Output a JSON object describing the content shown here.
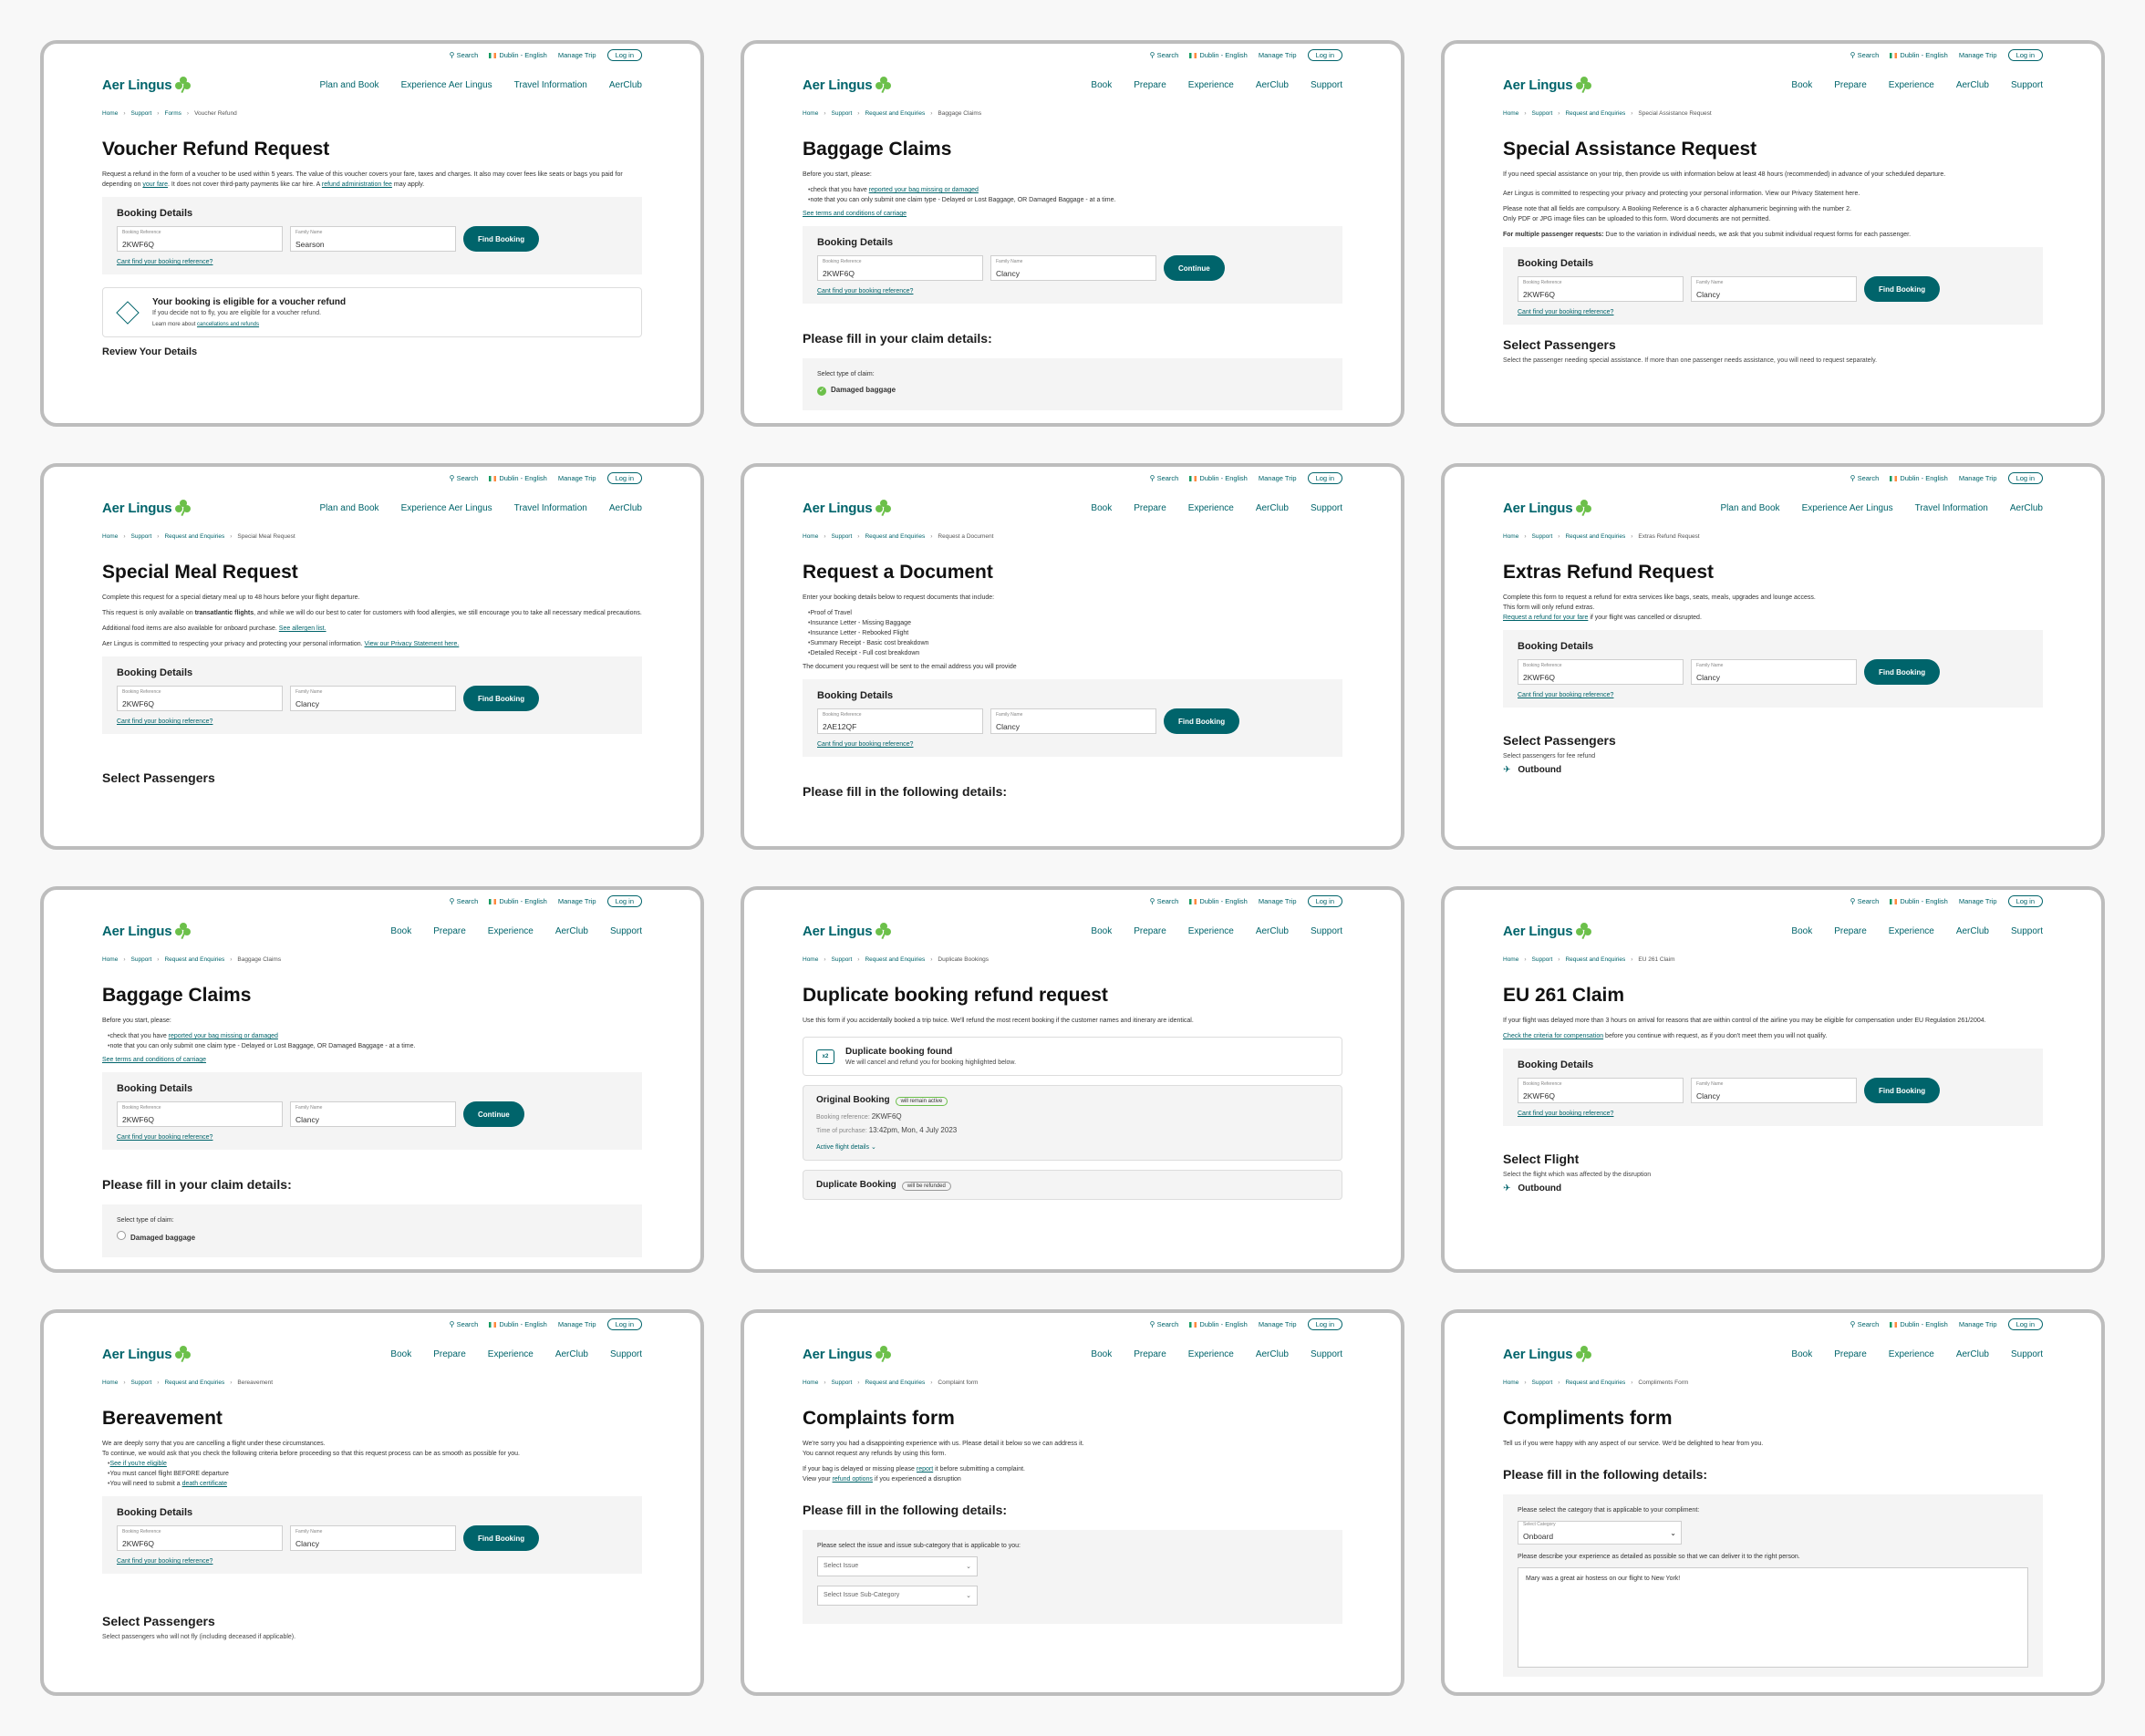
{
  "header": {
    "search": "Search",
    "locale": "Dublin - English",
    "manage": "Manage Trip",
    "login": "Log in",
    "brand": "Aer Lingus",
    "nav_a": [
      "Plan and Book",
      "Experience Aer Lingus",
      "Travel Information",
      "AerClub"
    ],
    "nav_b": [
      "Book",
      "Prepare",
      "Experience",
      "AerClub",
      "Support"
    ]
  },
  "common": {
    "booking_details": "Booking Details",
    "ref_label": "Booking Reference",
    "name_label": "Family Name",
    "cant_find": "Cant find your booking reference?",
    "find": "Find Booking",
    "continue": "Continue",
    "home": "Home",
    "support": "Support",
    "forms": "Forms",
    "req": "Request and Enquiries"
  },
  "cards": {
    "c1": {
      "crumb": "Voucher Refund",
      "title": "Voucher Refund Request",
      "p1a": "Request a refund in the form of a voucher to be used within 5 years. The value of this voucher covers your fare, taxes and charges. It also may cover fees like seats or bags you paid for depending on ",
      "p1link": "your fare",
      "p1b": ". It does not cover third-party payments like car hire. A ",
      "p1link2": "refund administration fee",
      "p1c": " may apply.",
      "ref": "2KWF6Q",
      "name": "Searson",
      "elig_title": "Your booking is eligible for a voucher refund",
      "elig_sub": "If you decide not to fly, you are eligible for a voucher refund.",
      "elig_more_a": "Learn more about ",
      "elig_more_link": "cancellations and refunds",
      "review": "Review Your Details"
    },
    "c2": {
      "crumb": "Baggage Claims",
      "title": "Baggage Claims",
      "intro": "Before you start, please:",
      "li1a": "check that you have ",
      "li1link": "reported your bag missing or damaged",
      "li2": "note that you can only submit one claim type - Delayed or Lost Baggage, OR Damaged Baggage - at a time.",
      "terms": "See terms and conditions of carriage",
      "ref": "2KWF6Q",
      "name": "Clancy",
      "h2": "Please fill in your claim details:",
      "claim_label": "Select type of claim:",
      "claim_opt": "Damaged baggage"
    },
    "c3": {
      "crumb": "Special Assistance Request",
      "title": "Special Assistance Request",
      "p1": "If you need special assistance on your trip, then provide us with information below at least 48 hours (recommended) in advance of your scheduled departure.",
      "p2": "Aer Lingus is committed to respecting your privacy and protecting your personal information. View our Privacy Statement here.",
      "p3": "Please note that all fields are compulsory. A Booking Reference is a 6 character alphanumeric beginning with the number 2.",
      "p4": "Only PDF or JPG image files can be uploaded to this form. Word documents are not permitted.",
      "p5b": "For multiple passenger requests:",
      "p5": " Due to the variation in individual needs, we ask that you submit individual request forms for each passenger.",
      "ref": "2KWF6Q",
      "name": "Clancy",
      "h2": "Select Passengers",
      "sub": "Select the passenger needing special assistance. If more than one passenger needs assistance, you will need to request separately."
    },
    "c4": {
      "crumb": "Special Meal Request",
      "title": "Special Meal Request",
      "p1": "Complete this request for a special dietary meal up to 48 hours before your flight departure.",
      "p2a": "This request is only available on ",
      "p2b": "transatlantic flights",
      "p2c": ", and while we will do our best to cater for customers with food allergies, we still encourage you to take all necessary medical precautions.",
      "p3a": "Additional food items are also available for onboard purchase. ",
      "p3link": "See allergen list.",
      "p4a": "Aer Lingus is committed to respecting your privacy and protecting your personal information. ",
      "p4link": "View our Privacy Statement here.",
      "ref": "2KWF6Q",
      "name": "Clancy",
      "h2": "Select Passengers"
    },
    "c5": {
      "crumb": "Request a Document",
      "title": "Request a Document",
      "intro": "Enter your booking details below to request documents that include:",
      "items": [
        "Proof of Travel",
        "Insurance Letter - Missing Baggage",
        "Insurance Letter - Rebooked Flight",
        "Summary Receipt - Basic cost breakdown",
        "Detailed Receipt - Full cost breakdown"
      ],
      "p2": "The document you request will be sent to the email address you will provide",
      "ref": "2AE12QF",
      "name": "Clancy",
      "h2": "Please fill in the following details:"
    },
    "c6": {
      "crumb": "Extras Refund Request",
      "title": "Extras Refund Request",
      "p1": "Complete this form to request a refund for extra services like bags, seats, meals, upgrades and lounge access.",
      "p2": "This form will only refund extras.",
      "p3link": "Request a refund for your fare",
      "p3": " if your flight was cancelled or disrupted.",
      "ref": "2KWF6Q",
      "name": "Clancy",
      "h2": "Select Passengers",
      "sub": "Select passengers for fee refund",
      "outbound": "Outbound"
    },
    "c7": {
      "crumb": "Baggage Claims",
      "title": "Baggage Claims",
      "intro": "Before you start, please:",
      "li1a": "check that you have ",
      "li1link": "reported your bag missing or damaged",
      "li2": "note that you can only submit one claim type - Delayed or Lost Baggage, OR Damaged Baggage - at a time.",
      "terms": "See terms and conditions of carriage",
      "ref": "2KWF6Q",
      "name": "Clancy",
      "h2": "Please fill in your claim details:",
      "claim_label": "Select type of claim:",
      "claim_opt": "Damaged baggage"
    },
    "c8": {
      "crumb": "Duplicate Bookings",
      "title": "Duplicate booking refund request",
      "p1": "Use this form if you accidentally booked a trip twice. We'll refund the most recent booking if the customer names and itinerary are identical.",
      "found_title": "Duplicate booking found",
      "found_sub": "We will cancel and refund you for booking highlighted below.",
      "orig_title": "Original Booking",
      "orig_tag": "will remain active",
      "ref_label": "Booking reference:",
      "ref": "2KWF6Q",
      "time_label": "Time of purchase:",
      "time": "13:42pm, Mon, 4 July 2023",
      "active": "Active flight details",
      "dup_title": "Duplicate Booking",
      "dup_tag": "will be refunded"
    },
    "c9": {
      "crumb": "EU 261 Claim",
      "title": "EU 261 Claim",
      "p1": "If your flight was delayed more than 3 hours on arrival for reasons that are within control of the airline you may be eligible for compensation under EU Regulation 261/2004.",
      "p2link": "Check the criteria for compensation",
      "p2": " before you continue with request, as if you don't meet them you will not qualify.",
      "ref": "2KWF6Q",
      "name": "Clancy",
      "h2": "Select Flight",
      "sub": "Select the flight which was affected by the disruption",
      "outbound": "Outbound"
    },
    "c10": {
      "crumb": "Bereavement",
      "title": "Bereavement",
      "p1": "We are deeply sorry that you are cancelling a flight under these circumstances.",
      "p2": "To continue, we would ask that you check the following criteria before proceeding so that this request process can be as smooth as possible for you.",
      "li1": "See if you're eligible",
      "li2": "You must cancel flight BEFORE departure",
      "li3a": "You will need to submit a ",
      "li3link": "death certificate",
      "ref": "2KWF6Q",
      "name": "Clancy",
      "h2": "Select Passengers",
      "sub": "Select passengers who will not fly (including deceased if applicable)."
    },
    "c11": {
      "crumb": "Complaint form",
      "title": "Complaints form",
      "p1": "We're sorry you had a disappointing experience with us. Please detail it below so we can address it.",
      "p2": "You cannot request any refunds by using this form.",
      "p3a": "If your bag is delayed or missing please ",
      "p3link": "report",
      "p3b": " it before submitting a complaint.",
      "p4a": "View your ",
      "p4link": "refund options",
      "p4b": " if you experienced a disruption",
      "h2": "Please fill in the following details:",
      "sel_label": "Please select the issue and issue sub-category that is applicable to you:",
      "sel1": "Select Issue",
      "sel2": "Select Issue Sub-Category"
    },
    "c12": {
      "crumb": "Compliments Form",
      "title": "Compliments form",
      "p1": "Tell us if you were happy with any aspect of our service. We'd be delighted to hear from you.",
      "h2": "Please fill in the following details:",
      "cat_label": "Please select the category that is applicable to your compliment:",
      "cat_sm": "Select Category",
      "cat_val": "Onboard",
      "desc_label": "Please describe your experience as detailed as possible so that we can deliver it to the right person.",
      "desc": "Mary was a great air hostess on our flight to New York!"
    }
  }
}
